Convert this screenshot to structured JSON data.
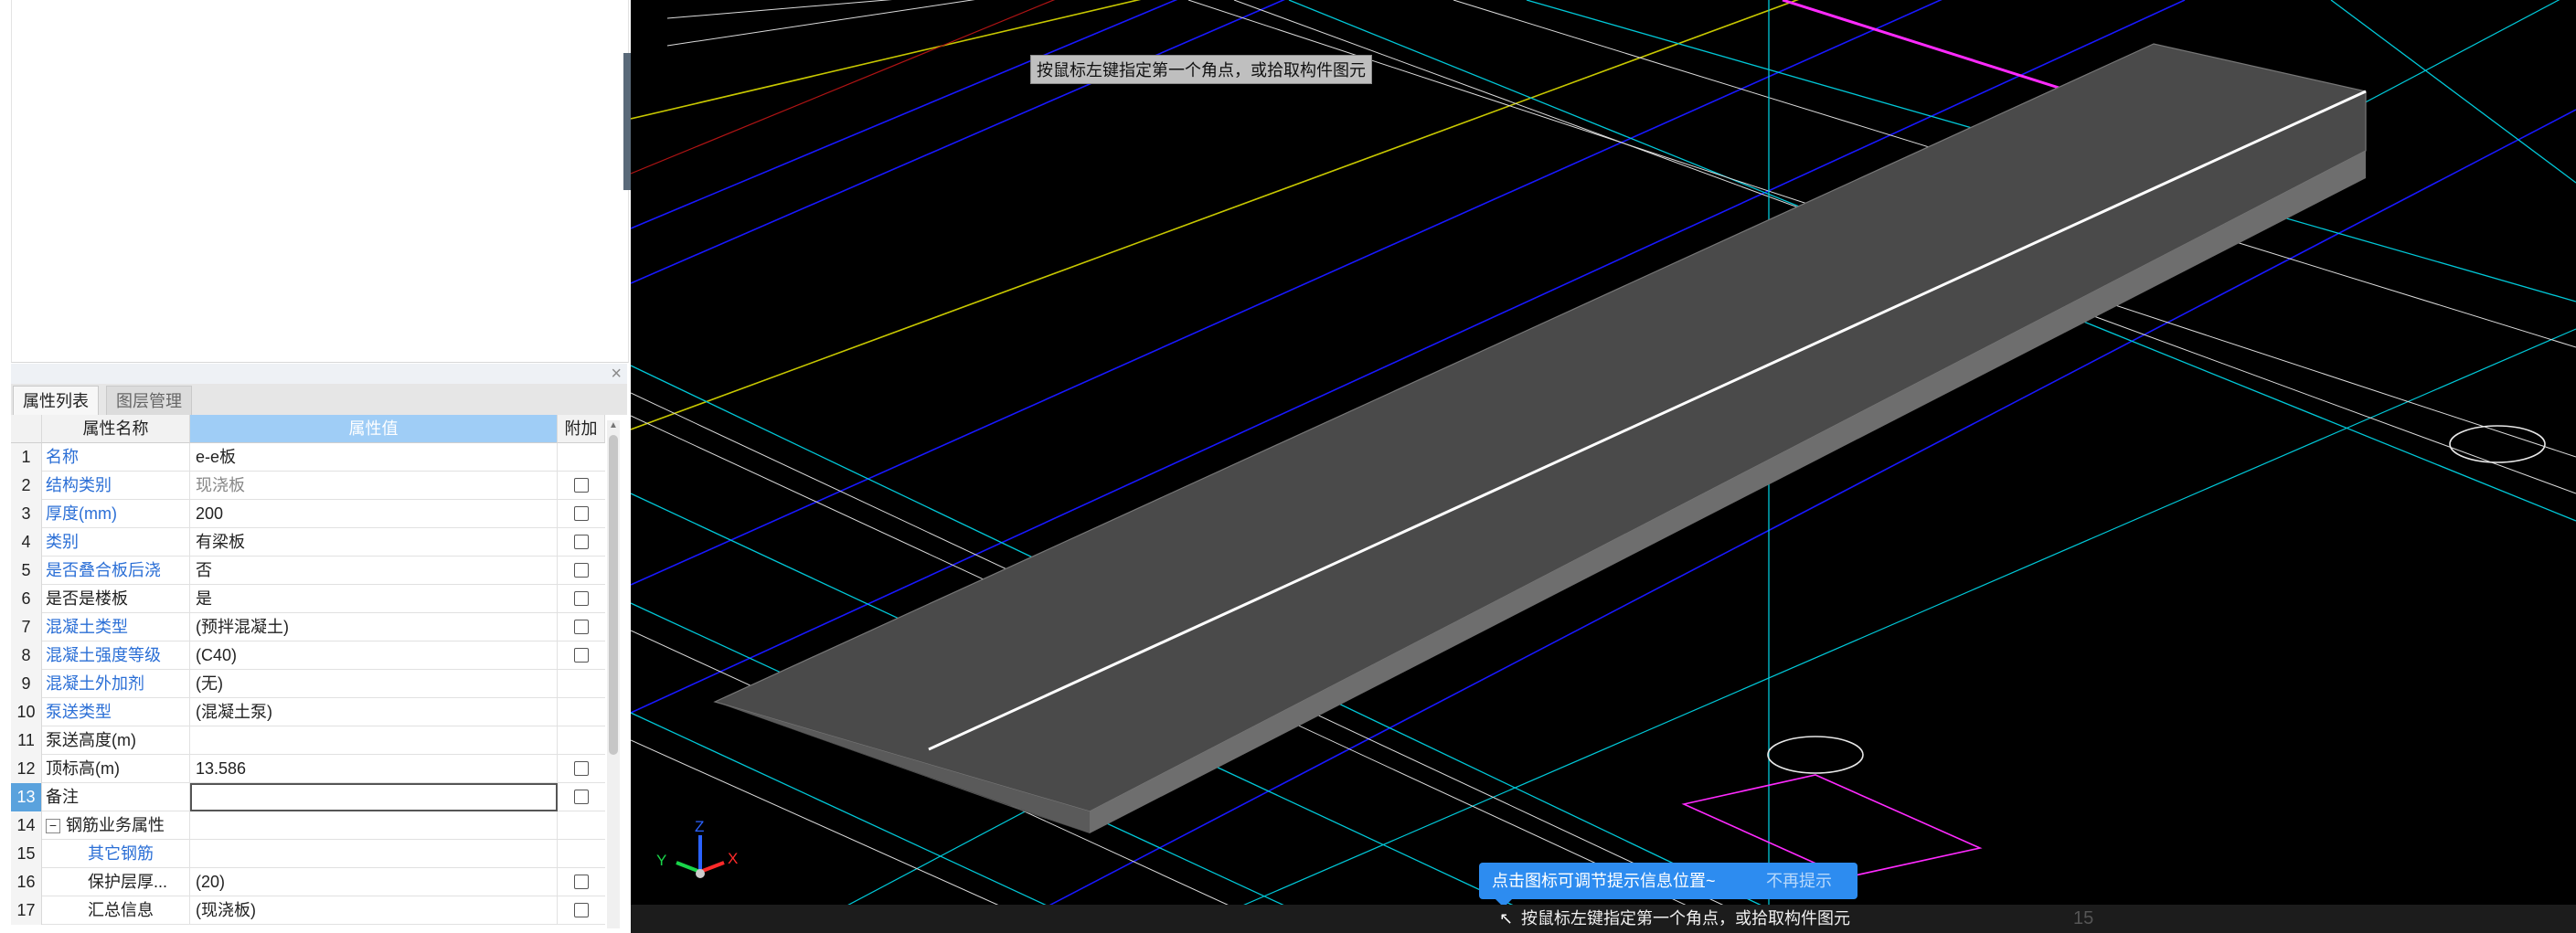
{
  "panel": {
    "tabs": [
      "属性列表",
      "图层管理"
    ],
    "close_glyph": "×",
    "headers": {
      "num": "",
      "name": "属性名称",
      "value": "属性值",
      "attach": "附加"
    }
  },
  "properties": [
    {
      "num": "1",
      "name": "名称",
      "value": "e-e板",
      "name_style": "blue",
      "checkbox": false
    },
    {
      "num": "2",
      "name": "结构类别",
      "value": "现浇板",
      "name_style": "blue",
      "value_style": "gray",
      "checkbox": true
    },
    {
      "num": "3",
      "name": "厚度(mm)",
      "value": "200",
      "name_style": "blue",
      "checkbox": true
    },
    {
      "num": "4",
      "name": "类别",
      "value": "有梁板",
      "name_style": "blue",
      "checkbox": true
    },
    {
      "num": "5",
      "name": "是否叠合板后浇",
      "value": "否",
      "name_style": "blue",
      "checkbox": true
    },
    {
      "num": "6",
      "name": "是否是楼板",
      "value": "是",
      "name_style": "dark",
      "checkbox": true
    },
    {
      "num": "7",
      "name": "混凝土类型",
      "value": "(预拌混凝土)",
      "name_style": "blue",
      "checkbox": true
    },
    {
      "num": "8",
      "name": "混凝土强度等级",
      "value": "(C40)",
      "name_style": "blue",
      "checkbox": true
    },
    {
      "num": "9",
      "name": "混凝土外加剂",
      "value": "(无)",
      "name_style": "blue",
      "checkbox": false
    },
    {
      "num": "10",
      "name": "泵送类型",
      "value": "(混凝土泵)",
      "name_style": "blue",
      "checkbox": false
    },
    {
      "num": "11",
      "name": "泵送高度(m)",
      "value": "",
      "name_style": "dark",
      "checkbox": false
    },
    {
      "num": "12",
      "name": "顶标高(m)",
      "value": "13.586",
      "name_style": "dark",
      "checkbox": true
    },
    {
      "num": "13",
      "name": "备注",
      "value": "",
      "name_style": "dark",
      "checkbox": true,
      "active": true
    },
    {
      "num": "14",
      "name": "钢筋业务属性",
      "value": "",
      "name_style": "dark",
      "checkbox": false,
      "group": true,
      "toggle": "−"
    },
    {
      "num": "15",
      "name": "其它钢筋",
      "value": "",
      "name_style": "blue",
      "checkbox": false,
      "child": true
    },
    {
      "num": "16",
      "name": "保护层厚...",
      "value": "(20)",
      "name_style": "dark",
      "checkbox": true,
      "child": true
    },
    {
      "num": "17",
      "name": "汇总信息",
      "value": "(现浇板)",
      "name_style": "dark",
      "checkbox": true,
      "child": true
    }
  ],
  "viewport": {
    "tooltip_top": "按鼠标左键指定第一个角点，或拾取构件图元",
    "hint_bubble": {
      "text": "点击图标可调节提示信息位置~",
      "dismiss": "不再提示"
    },
    "status": {
      "text": "按鼠标左键指定第一个角点，或拾取构件图元",
      "number": "15"
    },
    "axes": {
      "x": "X",
      "y": "Y",
      "z": "Z"
    },
    "colors": {
      "cyan": "#00c8d8",
      "blue": "#1818ff",
      "yellow": "#c8c800",
      "magenta": "#ff2aff",
      "white": "#dcdcdc",
      "slab_top": "#4a4a4a",
      "slab_side": "#6e6e6e",
      "slab_front": "#5a5a5a",
      "red": "#b01414"
    }
  }
}
